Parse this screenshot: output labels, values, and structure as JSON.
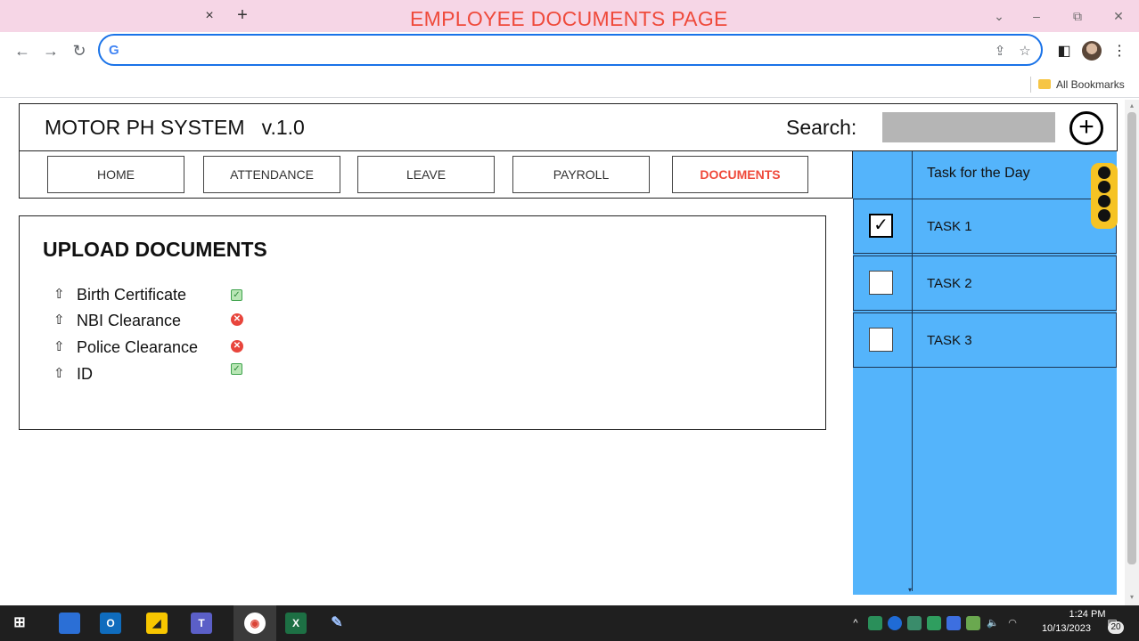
{
  "browser": {
    "tab_close": "×",
    "tab_new": "+",
    "page_heading": "EMPLOYEE DOCUMENTS PAGE",
    "window_buttons": {
      "minimize": "–",
      "restore": "⧉",
      "close": "✕",
      "menu": "⌄"
    },
    "nav": {
      "back": "←",
      "forward": "→",
      "reload": "↻"
    },
    "omnibox": {
      "logo": "G",
      "value": "",
      "share_icon": "⇪",
      "star_icon": "☆"
    },
    "toolbar_icons": {
      "sidepanel": "◧",
      "menu": "⋮"
    },
    "bookmarks": {
      "folder_label": "All Bookmarks"
    }
  },
  "app": {
    "title": "MOTOR PH SYSTEM   v.1.0",
    "search_label": "Search:",
    "search_value": "",
    "add_label": "+",
    "nav": [
      {
        "label": "HOME"
      },
      {
        "label": "ATTENDANCE"
      },
      {
        "label": "LEAVE"
      },
      {
        "label": "PAYROLL"
      },
      {
        "label": "DOCUMENTS",
        "active": true
      }
    ]
  },
  "upload": {
    "title": "UPLOAD DOCUMENTS",
    "upload_icon": "⇧",
    "documents": [
      {
        "label": "Birth Certificate",
        "status": "uploaded",
        "mark": "✓"
      },
      {
        "label": "NBI Clearance",
        "status": "missing",
        "mark": "✕"
      },
      {
        "label": "Police Clearance",
        "status": "missing",
        "mark": "✕"
      },
      {
        "label": "ID",
        "status": "uploaded",
        "mark": "✓"
      }
    ]
  },
  "tasks": {
    "header": "Task for the Day",
    "items": [
      {
        "label": "TASK 1",
        "checked": true,
        "mark": "✓"
      },
      {
        "label": "TASK 2",
        "checked": false
      },
      {
        "label": "TASK 3",
        "checked": false
      }
    ]
  },
  "colors": {
    "accent_red": "#ef4a3b",
    "tab_bar": "#f6d6e6",
    "task_panel": "#54b4fb",
    "task_menu": "#f6c324",
    "omnibox_border": "#1a73e8"
  },
  "taskbar": {
    "apps": [
      "windows-start-icon",
      "desktop-icon",
      "outlook-icon",
      "sticky-notes-icon",
      "teams-icon",
      "chrome-icon",
      "excel-icon",
      "paint-icon"
    ],
    "tray": {
      "chevron": "^",
      "volume": "🔈"
    },
    "time": "1:24 PM",
    "date": "10/13/2023",
    "notification_count": "20"
  }
}
